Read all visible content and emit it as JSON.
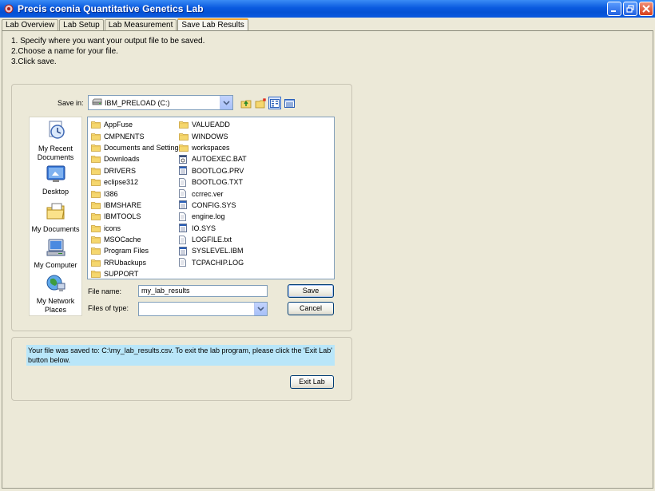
{
  "window": {
    "title": "Precis coenia Quantitative Genetics Lab",
    "controls": [
      "minimize",
      "maximize",
      "close"
    ]
  },
  "tabs": [
    {
      "label": "Lab Overview",
      "active": false
    },
    {
      "label": "Lab Setup",
      "active": false
    },
    {
      "label": "Lab Measurement",
      "active": false
    },
    {
      "label": "Save Lab Results",
      "active": true
    }
  ],
  "instructions": [
    "1. Specify where you want your output file to be saved.",
    "2.Choose a name for your file.",
    "3.Click save."
  ],
  "file_chooser": {
    "save_in_label": "Save in:",
    "save_in_value": "IBM_PRELOAD (C:)",
    "toolbar_icons": [
      "up-folder-icon",
      "new-folder-icon",
      "list-view-icon",
      "details-view-icon"
    ],
    "places": [
      {
        "label": "My Recent Documents",
        "icon": "recent-documents-icon"
      },
      {
        "label": "Desktop",
        "icon": "desktop-icon"
      },
      {
        "label": "My Documents",
        "icon": "my-documents-icon"
      },
      {
        "label": "My Computer",
        "icon": "my-computer-icon"
      },
      {
        "label": "My Network Places",
        "icon": "network-places-icon"
      }
    ],
    "files_col1": [
      {
        "name": "AppFuse",
        "type": "folder"
      },
      {
        "name": "CMPNENTS",
        "type": "folder"
      },
      {
        "name": "Documents and Settings",
        "type": "folder"
      },
      {
        "name": "Downloads",
        "type": "folder"
      },
      {
        "name": "DRIVERS",
        "type": "folder"
      },
      {
        "name": "eclipse312",
        "type": "folder"
      },
      {
        "name": "I386",
        "type": "folder"
      },
      {
        "name": "IBMSHARE",
        "type": "folder"
      },
      {
        "name": "IBMTOOLS",
        "type": "folder"
      },
      {
        "name": "icons",
        "type": "folder"
      },
      {
        "name": "MSOCache",
        "type": "folder"
      },
      {
        "name": "Program Files",
        "type": "folder"
      },
      {
        "name": "RRUbackups",
        "type": "folder"
      },
      {
        "name": "SUPPORT",
        "type": "folder"
      }
    ],
    "files_col2": [
      {
        "name": "VALUEADD",
        "type": "folder"
      },
      {
        "name": "WINDOWS",
        "type": "folder"
      },
      {
        "name": "workspaces",
        "type": "folder"
      },
      {
        "name": "AUTOEXEC.BAT",
        "type": "batch"
      },
      {
        "name": "BOOTLOG.PRV",
        "type": "system"
      },
      {
        "name": "BOOTLOG.TXT",
        "type": "text"
      },
      {
        "name": "ccrrec.ver",
        "type": "text"
      },
      {
        "name": "CONFIG.SYS",
        "type": "system"
      },
      {
        "name": "engine.log",
        "type": "text"
      },
      {
        "name": "IO.SYS",
        "type": "system"
      },
      {
        "name": "LOGFILE.txt",
        "type": "text"
      },
      {
        "name": "SYSLEVEL.IBM",
        "type": "system"
      },
      {
        "name": "TCPACHIP.LOG",
        "type": "text"
      }
    ],
    "file_name_label": "File name:",
    "file_name_value": "my_lab_results",
    "files_of_type_label": "Files of type:",
    "files_of_type_value": "",
    "save_label": "Save",
    "cancel_label": "Cancel"
  },
  "status": {
    "message": "Your file was saved to: C:\\my_lab_results.csv. To exit the lab program, please click the 'Exit Lab' button below.",
    "exit_label": "Exit Lab"
  },
  "colors": {
    "titlebar": "#0a5adf",
    "window_bg": "#ece9d8",
    "active_tab_accent": "#f1a532",
    "message_bg": "#b9e6f9"
  }
}
